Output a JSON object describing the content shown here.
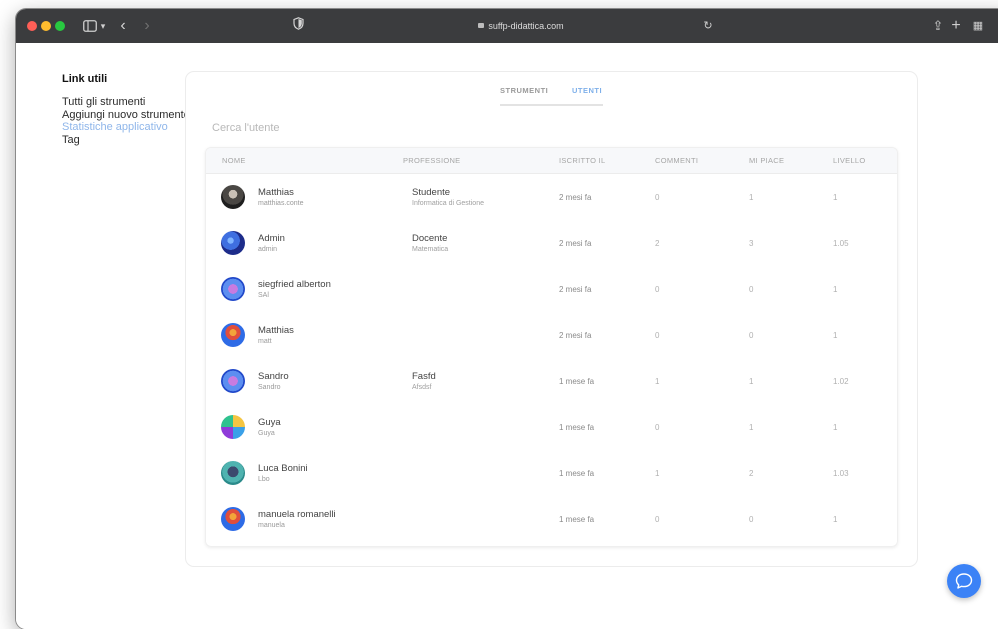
{
  "browser": {
    "url": "suffp-didattica.com",
    "colors": {
      "titlebar": "#3b3c3e",
      "red": "#fe5f57",
      "yellow": "#febc2e",
      "green": "#28c840"
    }
  },
  "sidebar": {
    "title": "Link utili",
    "links": [
      {
        "label": "Tutti gli strumenti",
        "active": false
      },
      {
        "label": "Aggiungi nuovo strumento",
        "active": false
      },
      {
        "label": "Statistiche applicativo",
        "active": true
      },
      {
        "label": "Tag",
        "active": false
      }
    ]
  },
  "tabs": [
    {
      "label": "STRUMENTI",
      "active": false
    },
    {
      "label": "UTENTI",
      "active": true
    }
  ],
  "search": {
    "placeholder": "Cerca l'utente",
    "value": ""
  },
  "table": {
    "headers": [
      "NOME",
      "PROFESSIONE",
      "ISCRITTO IL",
      "COMMENTI",
      "MI PIACE",
      "LIVELLO"
    ],
    "rows": [
      {
        "name": "Matthias",
        "handle": "matthias.conte",
        "profession": "Studente",
        "field": "Informatica di Gestione",
        "joined": "2 mesi fa",
        "comments": "0",
        "likes": "1",
        "level": "1",
        "avatar": "photo-avatar"
      },
      {
        "name": "Admin",
        "handle": "admin",
        "profession": "Docente",
        "field": "Matematica",
        "joined": "2 mesi fa",
        "comments": "2",
        "likes": "3",
        "level": "1.05",
        "avatar": "galaxy-avatar"
      },
      {
        "name": "siegfried alberton",
        "handle": "SAl",
        "profession": "",
        "field": "",
        "joined": "2 mesi fa",
        "comments": "0",
        "likes": "0",
        "level": "1",
        "avatar": "planet-avatar"
      },
      {
        "name": "Matthias",
        "handle": "matt",
        "profession": "",
        "field": "",
        "joined": "2 mesi fa",
        "comments": "0",
        "likes": "0",
        "level": "1",
        "avatar": "mushroom-avatar"
      },
      {
        "name": "Sandro",
        "handle": "Sandro",
        "profession": "Fasfd",
        "field": "Afsdsf",
        "joined": "1 mese fa",
        "comments": "1",
        "likes": "1",
        "level": "1.02",
        "avatar": "planet-avatar"
      },
      {
        "name": "Guya",
        "handle": "Guya",
        "profession": "",
        "field": "",
        "joined": "1 mese fa",
        "comments": "0",
        "likes": "1",
        "level": "1",
        "avatar": "abstract-avatar"
      },
      {
        "name": "Luca Bonini",
        "handle": "Lbo",
        "profession": "",
        "field": "",
        "joined": "1 mese fa",
        "comments": "1",
        "likes": "2",
        "level": "1.03",
        "avatar": "robot-avatar"
      },
      {
        "name": "manuela romanelli",
        "handle": "manuela",
        "profession": "",
        "field": "",
        "joined": "1 mese fa",
        "comments": "0",
        "likes": "0",
        "level": "1",
        "avatar": "mushroom-avatar"
      }
    ]
  },
  "chat": {
    "icon": "chat-bubble-icon",
    "color": "#3b82f6"
  }
}
